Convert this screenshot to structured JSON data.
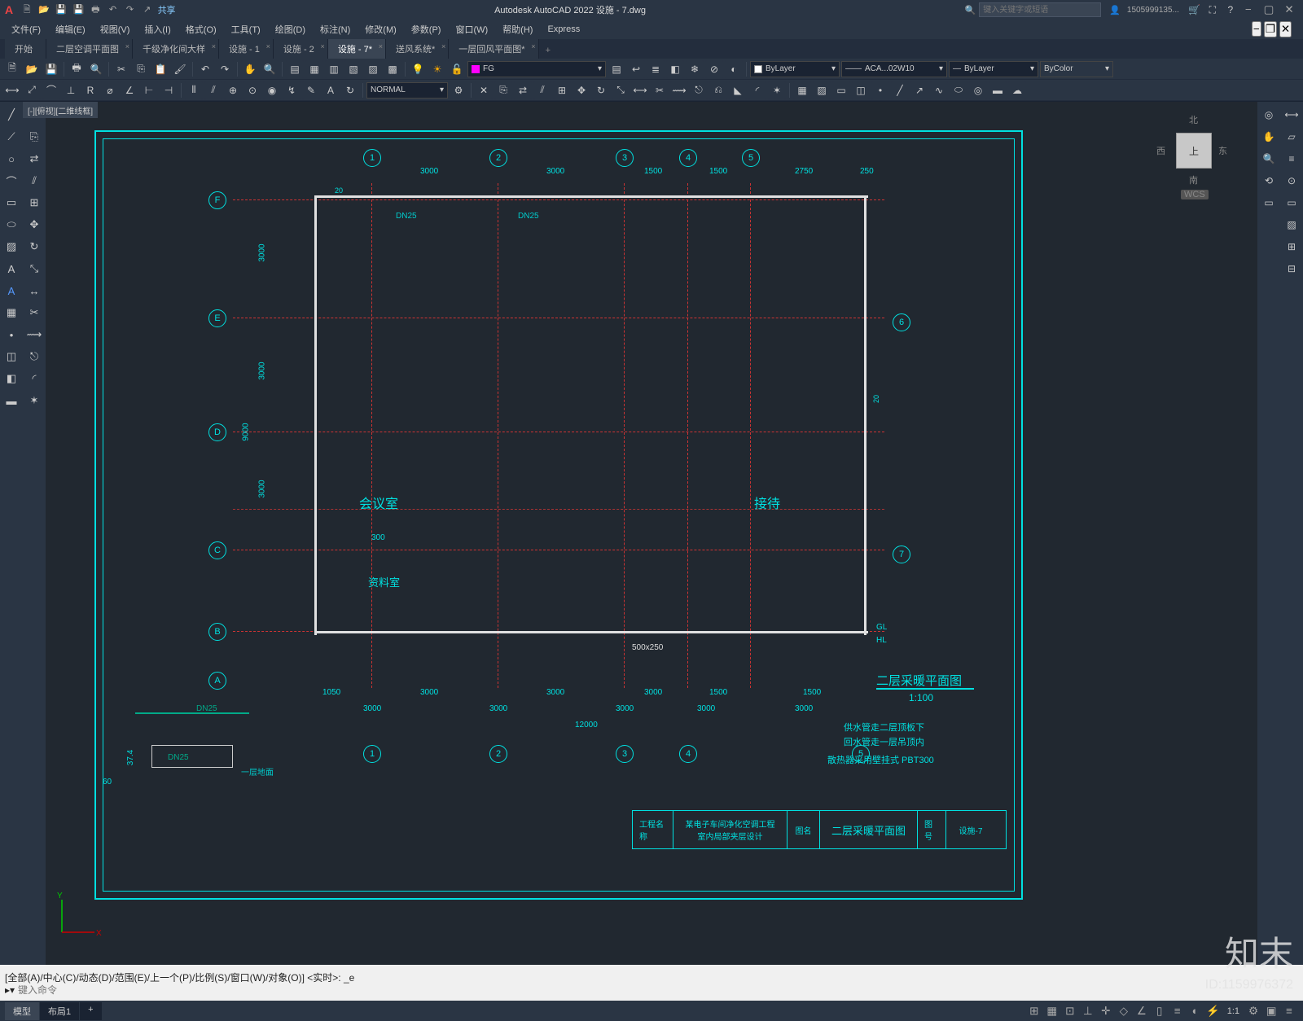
{
  "app": {
    "title": "Autodesk AutoCAD 2022   设施 - 7.dwg"
  },
  "titlebar": {
    "share": "共享",
    "search_placeholder": "键入关键字或短语",
    "user": "1505999135..."
  },
  "menus": [
    "文件(F)",
    "编辑(E)",
    "视图(V)",
    "插入(I)",
    "格式(O)",
    "工具(T)",
    "绘图(D)",
    "标注(N)",
    "修改(M)",
    "参数(P)",
    "窗口(W)",
    "帮助(H)",
    "Express"
  ],
  "filetabs": [
    {
      "label": "开始",
      "sel": false
    },
    {
      "label": "二层空调平面图",
      "sel": false
    },
    {
      "label": "千级净化间大样",
      "sel": false
    },
    {
      "label": "设施 - 1",
      "sel": false
    },
    {
      "label": "设施 - 2",
      "sel": false
    },
    {
      "label": "设施 - 7*",
      "sel": true
    },
    {
      "label": "送风系统*",
      "sel": false
    },
    {
      "label": "一层回风平面图*",
      "sel": false
    }
  ],
  "layer": {
    "current": "FG",
    "linetype": "ACA...02W10",
    "lineweight": "ByLayer",
    "bylayer": "ByLayer",
    "color": "ByColor",
    "normal": "NORMAL"
  },
  "viewport_label": "[-][俯视][二维线框]",
  "viewcube": {
    "top": "上",
    "n": "北",
    "s": "南",
    "e": "东",
    "w": "西",
    "wcs": "WCS"
  },
  "drawing": {
    "grid_top": [
      {
        "n": "1",
        "dim": "3000"
      },
      {
        "n": "2",
        "dim": "3000"
      },
      {
        "n": "3",
        "dim": "1500"
      },
      {
        "n": "4",
        "dim": "1500"
      },
      {
        "n": "5",
        "dim": "2750"
      }
    ],
    "grid_top_extra": "250",
    "grid_left": [
      "F",
      "E",
      "D",
      "C",
      "B",
      "A"
    ],
    "grid_right": [
      "6",
      "7"
    ],
    "dims_v": [
      "3000",
      "3000",
      "9000",
      "3000"
    ],
    "dims_bottom_row1": [
      "1050",
      "3000",
      "3000",
      "3000",
      "1500",
      "1500"
    ],
    "dims_bottom_row2": [
      "3000",
      "3000",
      "3000",
      "3000",
      "3000"
    ],
    "dims_total": "12000",
    "dims_side": [
      "20",
      "20"
    ],
    "dim_300": "300",
    "dim_374": "37.4",
    "dim_60": "60",
    "rooms": {
      "meeting": "会议室",
      "data": "资料室",
      "reception": "接待"
    },
    "pipe_labels": [
      "DN25",
      "DN25",
      "DN25",
      "DN25"
    ],
    "duct": "500x250",
    "labels": {
      "gl": "GL",
      "hl": "HL"
    },
    "level_label": "一层地面",
    "title": "二层采暖平面图",
    "scale": "1:100",
    "notes": [
      "供水管走二层顶板下",
      "回水管走一层吊顶内",
      "散热器采用壁挂式 PBT300"
    ],
    "titleblock": {
      "proj_lbl": "工程名称",
      "proj": "某电子车间净化空调工程\n室内局部夹层设计",
      "dwg_lbl": "图名",
      "dwg": "二层采暖平面图",
      "no_lbl": "图号",
      "no": "设施-7"
    }
  },
  "cmd": {
    "line1": "[全部(A)/中心(C)/动态(D)/范围(E)/上一个(P)/比例(S)/窗口(W)/对象(O)] <实时>:  _e",
    "prompt": "键入命令"
  },
  "status": {
    "model": "模型",
    "layout": "布局1",
    "scale": "1:1"
  },
  "watermark": {
    "brand": "知末",
    "id": "ID:1159976372"
  }
}
